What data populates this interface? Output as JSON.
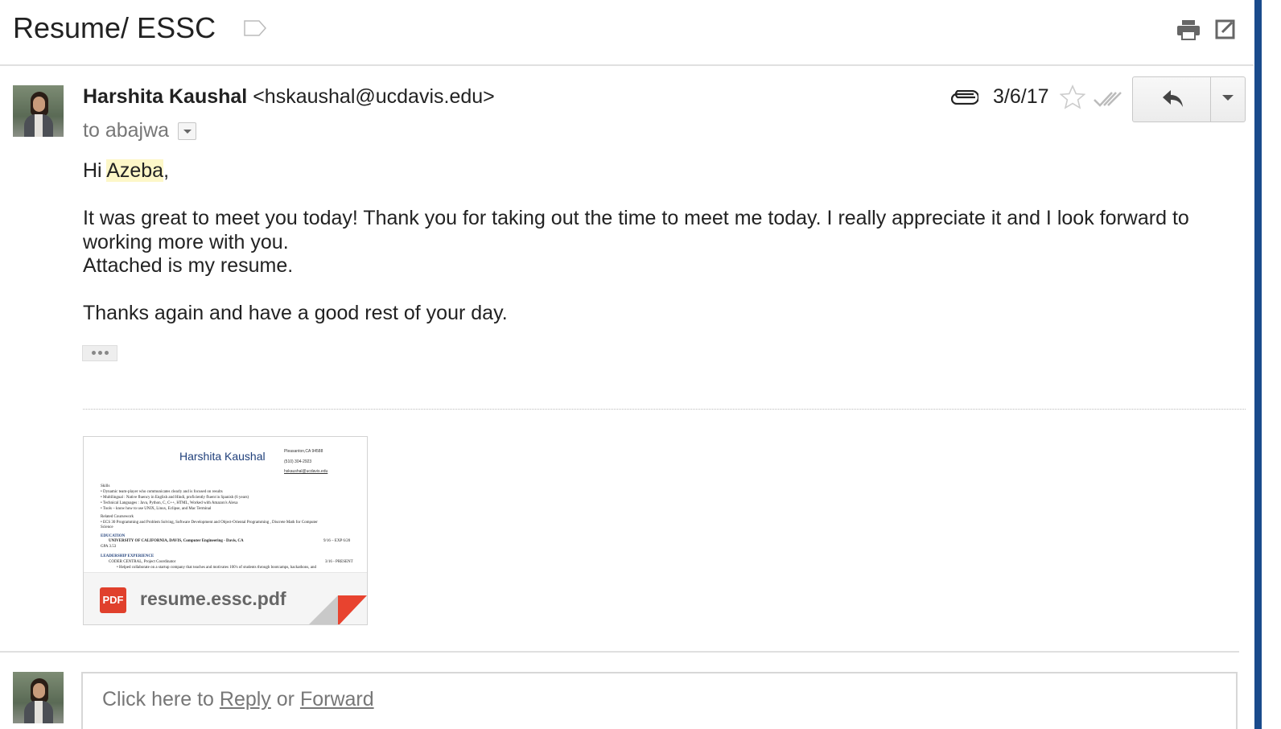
{
  "thread": {
    "subject": "Resume/ ESSC"
  },
  "message": {
    "sender_name": "Harshita Kaushal",
    "sender_email": "<hskaushal@ucdavis.edu>",
    "to_prefix": "to",
    "to_name": "abajwa",
    "date": "3/6/17",
    "body": {
      "greeting_prefix": "Hi ",
      "greeting_name": "Azeba",
      "greeting_suffix": ",",
      "paragraph1": "It was great to meet you today! Thank you for taking out the time to meet me today. I really appreciate it and I look forward to working more with you.",
      "paragraph2": "Attached is my resume.",
      "paragraph3": "Thanks again and have a good rest of your day."
    }
  },
  "attachment": {
    "filename": "resume.essc.pdf",
    "type_badge": "PDF",
    "preview": {
      "name": "Harshita Kaushal",
      "contact": [
        "Pleasanton,CA 94588",
        "(510) 304-2923",
        "hskaushal@ucdavis.edu"
      ],
      "lines": [
        "Skills",
        "•  Dynamic team-player who communicates clearly and is focused on results",
        "•  Multilingual : Native fluency in English and Hindi, proficiently fluent in Spanish (6 years)",
        "•  Technical Languages : Java, Python, C, C++, HTML, Worked with Amazon's Alexa",
        "•  Tools – know how to use UNIX, Linux, Eclipse, and Mac Terminal",
        "Related Coursework",
        "•  ECS 30   Programming and Problem Solving, Software Development and Object-Oriental Programming , Discrete Math for Computer",
        "    Science"
      ],
      "education_head": "EDUCATION",
      "education_line": "UNIVERSITY OF CALIFORNIA, DAVIS, Computer Engineering - Davis, CA",
      "education_dates": "9/16 – EXP 6/20",
      "gpa": "GPA   3.53",
      "leadership_head": "LEADERSHIP EXPERIENCE",
      "leadership_line": "CODER CENTRAL, Project Coordinator",
      "leadership_dates": "3/16 - PRESENT",
      "leadership_bullet": "•   Helped collaborate on a startup company that teaches and motivates 100's of students through bootcamps, hackathons, and"
    }
  },
  "reply": {
    "prefix": "Click here to ",
    "reply_link": "Reply",
    "middle": " or ",
    "forward_link": "Forward"
  },
  "icons": {
    "label": "label-tag-icon",
    "print": "print-icon",
    "popout": "open-in-new-window-icon",
    "attachment": "paperclip-icon",
    "star": "star-icon",
    "read_receipt": "double-check-icon",
    "reply": "reply-arrow-icon",
    "more": "chevron-down-icon"
  },
  "colors": {
    "highlight": "#fdf7c8",
    "pdf_red": "#e0402c",
    "accent_bar": "#1a4b8c"
  }
}
